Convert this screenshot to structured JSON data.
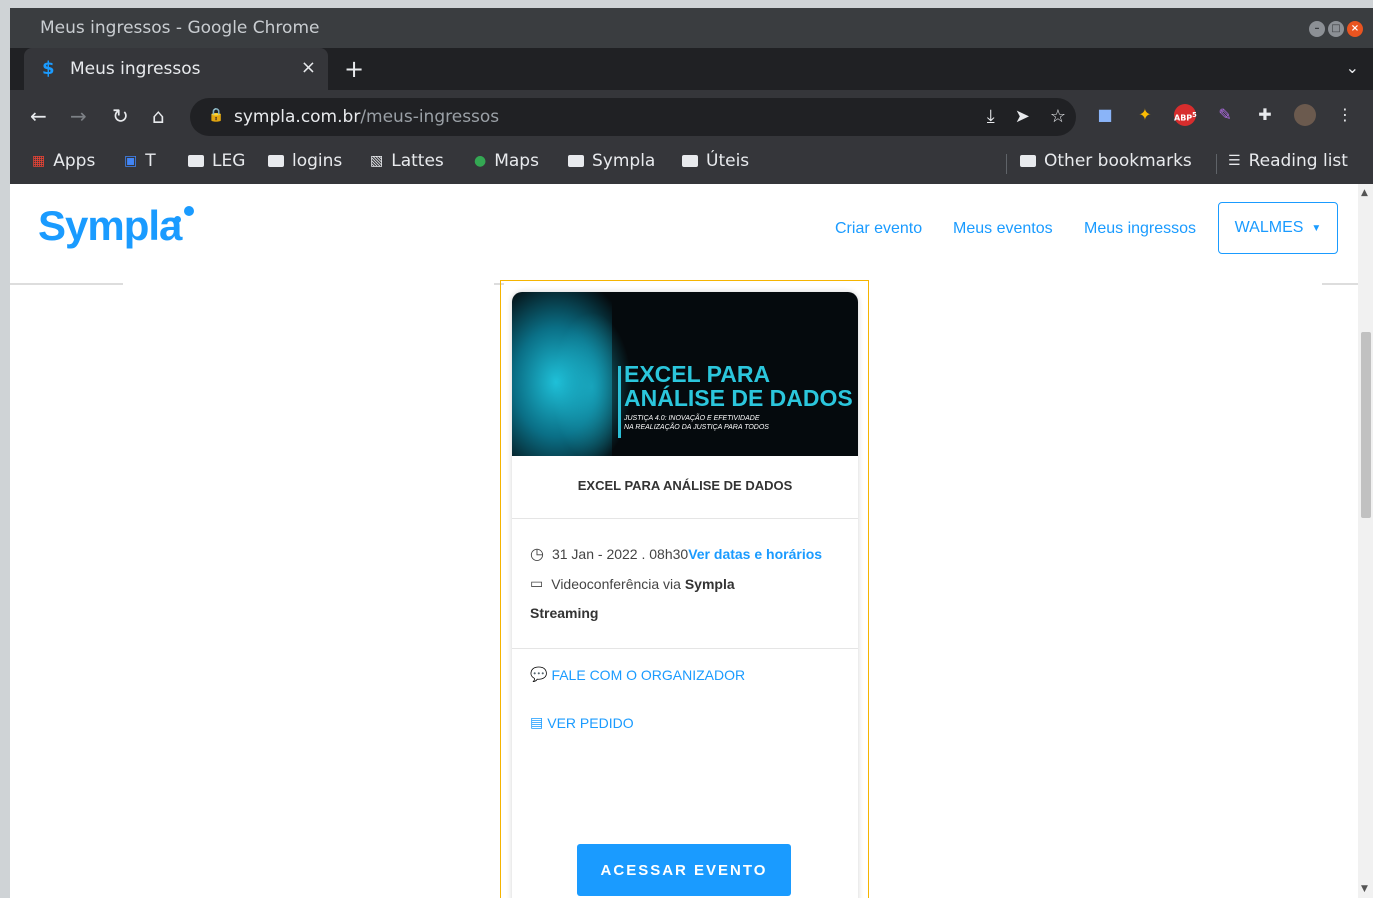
{
  "window": {
    "title": "Meus ingressos - Google Chrome"
  },
  "tab": {
    "label": "Meus ingressos",
    "close": "×"
  },
  "toolbar": {
    "url_host": "sympla.com.br",
    "url_path": "/meus-ingressos",
    "abp_label": "ABP",
    "abp_count": "5"
  },
  "bookmarks": {
    "items": [
      "Apps",
      "T",
      "LEG",
      "logins",
      "Lattes",
      "Maps",
      "Sympla",
      "Úteis"
    ],
    "other": "Other bookmarks",
    "reading": "Reading list"
  },
  "site": {
    "logo": "Sympla",
    "nav": [
      "Criar evento",
      "Meus eventos",
      "Meus ingressos"
    ],
    "user": "WALMES"
  },
  "card": {
    "banner_title_1": "EXCEL PARA",
    "banner_title_2": "ANÁLISE DE DADOS",
    "banner_sub_1": "JUSTIÇA 4.0: INOVAÇÃO E EFETIVIDADE",
    "banner_sub_2": "NA REALIZAÇÃO DA JUSTIÇA PARA TODOS",
    "title": "EXCEL PARA ANÁLISE DE DADOS",
    "date": "31 Jan - 2022 . 08h30",
    "date_link": "Ver datas e horários",
    "location_prefix": "Videoconferência via",
    "location_bold_1": "Sympla",
    "location_bold_2": "Streaming",
    "contact": "FALE COM O ORGANIZADOR",
    "order": "VER PEDIDO",
    "button": "ACESSAR EVENTO"
  },
  "colors": {
    "brand": "#1a9bff",
    "highlight": "#f5b400",
    "chrome_dark": "#35363a"
  }
}
